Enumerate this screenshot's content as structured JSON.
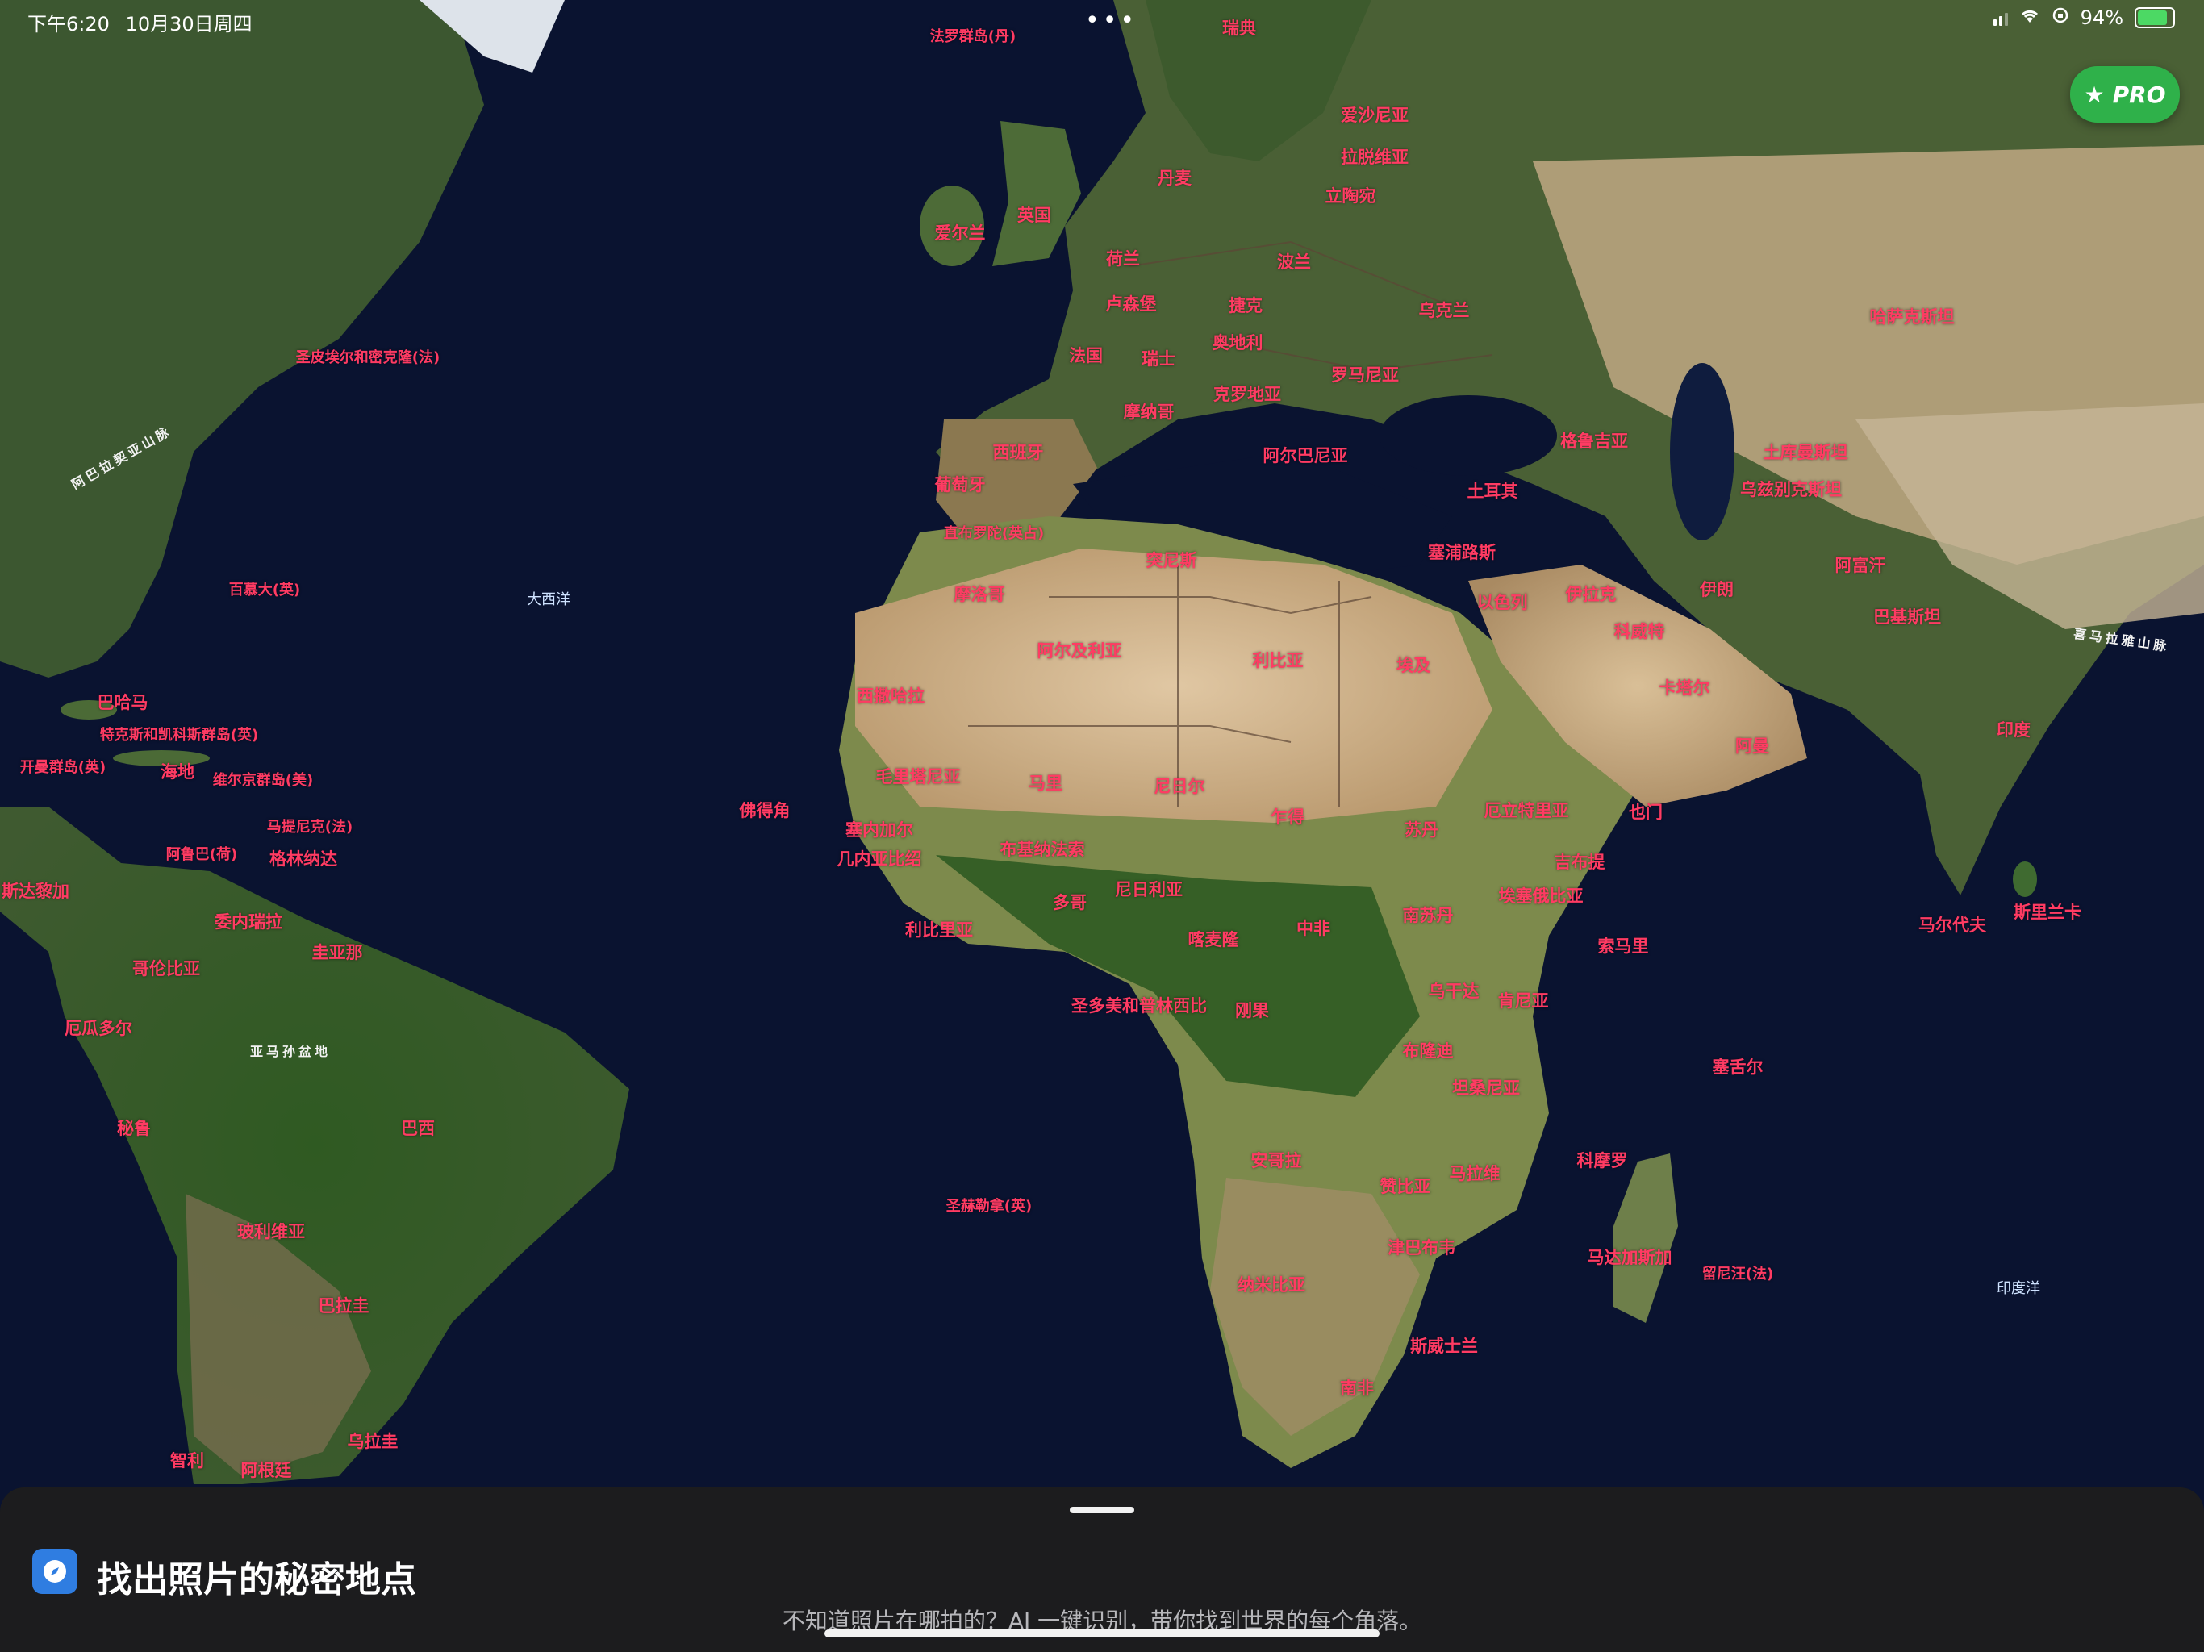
{
  "status_bar": {
    "time": "下午6:20",
    "date": "10月30日周四",
    "battery": "94%",
    "battery_level": 0.94,
    "multitask_dots": "•••"
  },
  "pro_badge": {
    "icon": "star-icon",
    "label": "PRO",
    "color": "#2fb14a"
  },
  "map": {
    "style": "satellite",
    "ocean_color": "#0a1330",
    "land_colors": {
      "forest": "#3b5a2a",
      "desert": "#c9ab84",
      "ice": "#d8dde2"
    },
    "label_color": "#ff3b63",
    "countries": [
      "法罗群岛(丹)",
      "瑞典",
      "爱沙尼亚",
      "拉脱维亚",
      "立陶宛",
      "丹麦",
      "英国",
      "爱尔兰",
      "荷兰",
      "波兰",
      "卢森堡",
      "捷克",
      "乌克兰",
      "奥地利",
      "法国",
      "瑞士",
      "罗马尼亚",
      "摩纳哥",
      "克罗地亚",
      "哈萨克斯坦",
      "西班牙",
      "阿尔巴尼亚",
      "葡萄牙",
      "格鲁吉亚",
      "土库曼斯坦",
      "土耳其",
      "乌兹别克斯坦",
      "直布罗陀(英占)",
      "突尼斯",
      "塞浦路斯",
      "阿富汗",
      "摩洛哥",
      "巴基斯坦",
      "伊拉克",
      "伊朗",
      "以色列",
      "科威特",
      "阿尔及利亚",
      "利比亚",
      "埃及",
      "卡塔尔",
      "西撒哈拉",
      "巴哈马",
      "印度",
      "特克斯和凯科斯群岛(英)",
      "阿曼",
      "开曼群岛(英)",
      "海地",
      "维尔京群岛(美)",
      "毛里塔尼亚",
      "马里",
      "尼日尔",
      "佛得角",
      "乍得",
      "苏丹",
      "厄立特里亚",
      "也门",
      "马提尼克(法)",
      "塞内加尔",
      "阿鲁巴(荷)",
      "格林纳达",
      "几内亚比绍",
      "吉布提",
      "布基纳法索",
      "斯里兰卡",
      "埃塞俄比亚",
      "多哥",
      "尼日利亚",
      "中非",
      "南苏丹",
      "马尔代夫",
      "委内瑞拉",
      "圭亚那",
      "利比里亚",
      "喀麦隆",
      "索马里",
      "哥伦比亚",
      "乌干达",
      "圣多美和普林西比",
      "刚果",
      "肯尼亚",
      "厄瓜多尔",
      "布隆迪",
      "塞舌尔",
      "坦桑尼亚",
      "秘鲁",
      "巴西",
      "安哥拉",
      "马拉维",
      "科摩罗",
      "赞比亚",
      "圣赫勒拿(英)",
      "玻利维亚",
      "津巴布韦",
      "马达加斯加",
      "留尼汪(法)",
      "纳米比亚",
      "巴拉圭",
      "斯威士兰",
      "南非",
      "乌拉圭",
      "智利",
      "阿根廷",
      "圣皮埃尔和密克隆(法)",
      "百慕大(英)",
      "斯达黎加"
    ],
    "oceans": [
      "大西洋",
      "印度洋"
    ],
    "features": [
      "阿巴拉契亚山脉",
      "亚马孙盆地",
      "喜马拉雅山脉"
    ]
  },
  "sheet": {
    "title": "找出照片的秘密地点",
    "subtitle": "不知道照片在哪拍的？AI 一键识别，带你找到世界的每个角落。",
    "icon": "compass-icon"
  }
}
